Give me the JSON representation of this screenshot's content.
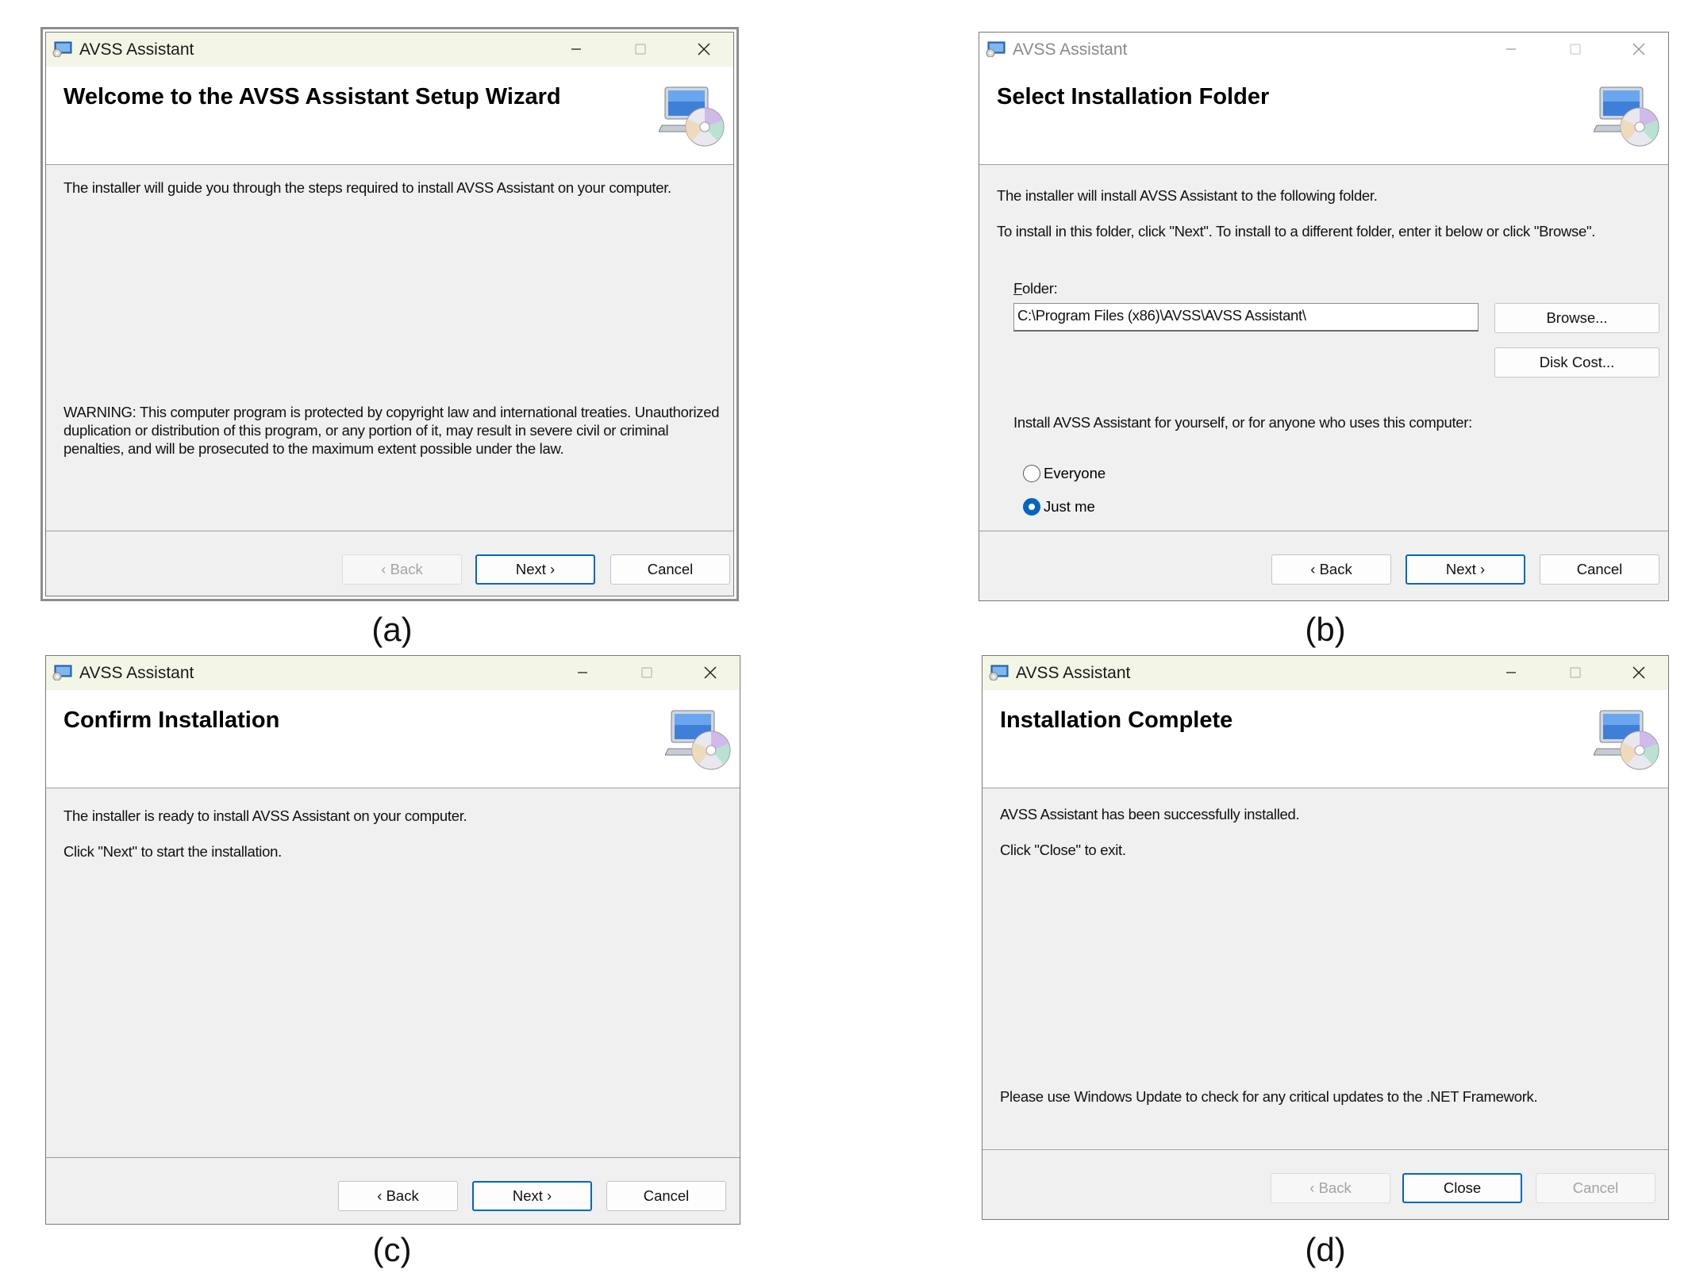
{
  "app_title": "AVSS Assistant",
  "panels": {
    "a": {
      "caption": "(a)",
      "banner_title": "Welcome to the AVSS Assistant Setup Wizard",
      "paragraphs": [
        "The installer will guide you through the steps required to install AVSS Assistant on your computer.",
        "WARNING: This computer program is protected by copyright law and international treaties. Unauthorized duplication or distribution of this program, or any portion of it, may result in severe civil or criminal penalties, and will be prosecuted to the maximum extent possible under the law."
      ],
      "buttons": {
        "back": "‹ Back",
        "next": "Next ›",
        "cancel": "Cancel"
      },
      "back_enabled": false
    },
    "b": {
      "caption": "(b)",
      "banner_title": "Select Installation Folder",
      "paragraphs": [
        "The installer will install AVSS Assistant to the following folder.",
        "To install in this folder, click \"Next\". To install to a different folder, enter it below or click \"Browse\"."
      ],
      "folder_label": "Folder:",
      "folder_value": "C:\\Program Files (x86)\\AVSS\\AVSS Assistant\\",
      "browse_label": "Browse...",
      "disk_cost_label": "Disk Cost...",
      "install_for_label": "Install AVSS Assistant for yourself, or for anyone who uses this computer:",
      "radio_options": [
        "Everyone",
        "Just me"
      ],
      "radio_selected": "Just me",
      "buttons": {
        "back": "‹ Back",
        "next": "Next ›",
        "cancel": "Cancel"
      },
      "window_inactive": true
    },
    "c": {
      "caption": "(c)",
      "banner_title": "Confirm Installation",
      "paragraphs": [
        "The installer is ready to install AVSS Assistant on your computer.",
        "Click \"Next\" to start the installation."
      ],
      "buttons": {
        "back": "‹ Back",
        "next": "Next ›",
        "cancel": "Cancel"
      }
    },
    "d": {
      "caption": "(d)",
      "banner_title": "Installation Complete",
      "paragraphs": [
        "AVSS Assistant has been successfully installed.",
        "Click \"Close\" to exit.",
        "Please use Windows Update to check for any critical updates to the .NET Framework."
      ],
      "buttons": {
        "back": "‹ Back",
        "close": "Close",
        "cancel": "Cancel"
      },
      "back_enabled": false,
      "cancel_enabled": false
    }
  },
  "icons": {
    "app": "installer-app-icon",
    "setup": "computer-with-cd-icon",
    "minimize": "minimize-icon",
    "maximize": "maximize-icon",
    "close": "close-icon"
  },
  "colors": {
    "accent": "#0067c0",
    "titlebar_active": "#f3f6e6",
    "dialog_bg": "#f0f0f0"
  }
}
